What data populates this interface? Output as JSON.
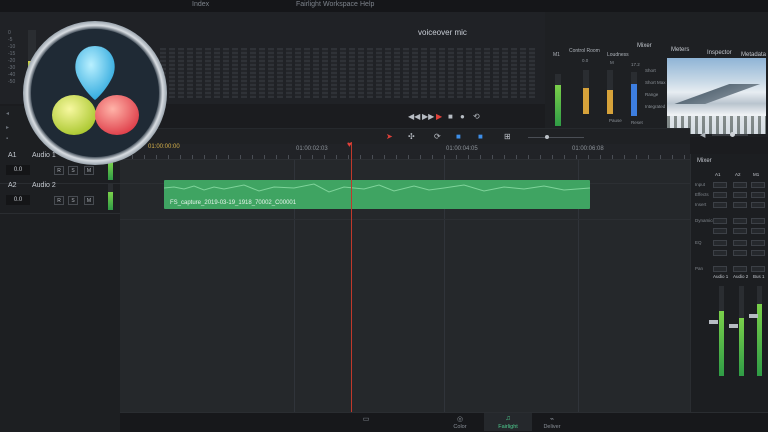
{
  "menu": {
    "items": [
      "Index",
      "Fairlight",
      "Workspace",
      "Help"
    ]
  },
  "meter_bridge": {
    "title": "voiceover mic",
    "scale": [
      "0",
      "-5",
      "-10",
      "-15",
      "-20",
      "-30",
      "-40",
      "-50"
    ],
    "level_fraction": 0.55
  },
  "right_panel": {
    "tabs": [
      "Mixer",
      "Meters",
      "Inspector",
      "Metadata"
    ],
    "sections": [
      "M1",
      "Control Room",
      "Loudness"
    ],
    "loudness_labels": [
      "M",
      "S",
      "I"
    ],
    "loudness_values": [
      "0.0",
      "17.2"
    ],
    "side_labels": [
      "Short",
      "Short Max",
      "Range",
      "Integrated"
    ],
    "buttons": [
      "Pause",
      "Reset"
    ]
  },
  "transport": {
    "buttons": [
      "rewind",
      "fast-forward",
      "play",
      "stop",
      "record",
      "loop"
    ]
  },
  "toolbar": {
    "tools": [
      "pointer",
      "range",
      "snap",
      "flag",
      "marker"
    ]
  },
  "tracks": [
    {
      "id": "A1",
      "name": "Audio 1",
      "volume": "0.0",
      "chips": [
        "R",
        "S",
        "M"
      ]
    },
    {
      "id": "A2",
      "name": "Audio 2",
      "volume": "0.0",
      "chips": [
        "R",
        "S",
        "M"
      ]
    }
  ],
  "ruler": {
    "start_tc": "01:00:00:00",
    "timecodes": [
      "01:00:02:03",
      "01:00:04:05",
      "01:00:06:08"
    ]
  },
  "clip": {
    "name": "FS_capture_2019-03-19_1918_70002_C00001"
  },
  "mixer": {
    "title": "Mixer",
    "channels": [
      "A1",
      "A2",
      "M1"
    ],
    "row_labels": [
      "Input",
      "Effects",
      "Insert",
      "Dynamics",
      "EQ",
      "Pan"
    ],
    "strip_names": [
      "Audio 1",
      "Audio 2",
      "Bus 1"
    ]
  },
  "page_nav": {
    "items": [
      {
        "icon": "edit-icon",
        "label": ""
      },
      {
        "icon": "color-icon",
        "label": "Color"
      },
      {
        "icon": "fairlight-icon",
        "label": "Fairlight"
      },
      {
        "icon": "deliver-icon",
        "label": "Deliver"
      }
    ],
    "active": "Fairlight"
  },
  "colors": {
    "clip": "#3fa462",
    "playhead": "#e0413a",
    "fairlight_accent": "#4ecb8f",
    "meter_green": "#39a64b",
    "logo_blue": "#5fc8f0",
    "logo_yellow": "#d6e04a",
    "logo_red": "#ea5a5a"
  }
}
